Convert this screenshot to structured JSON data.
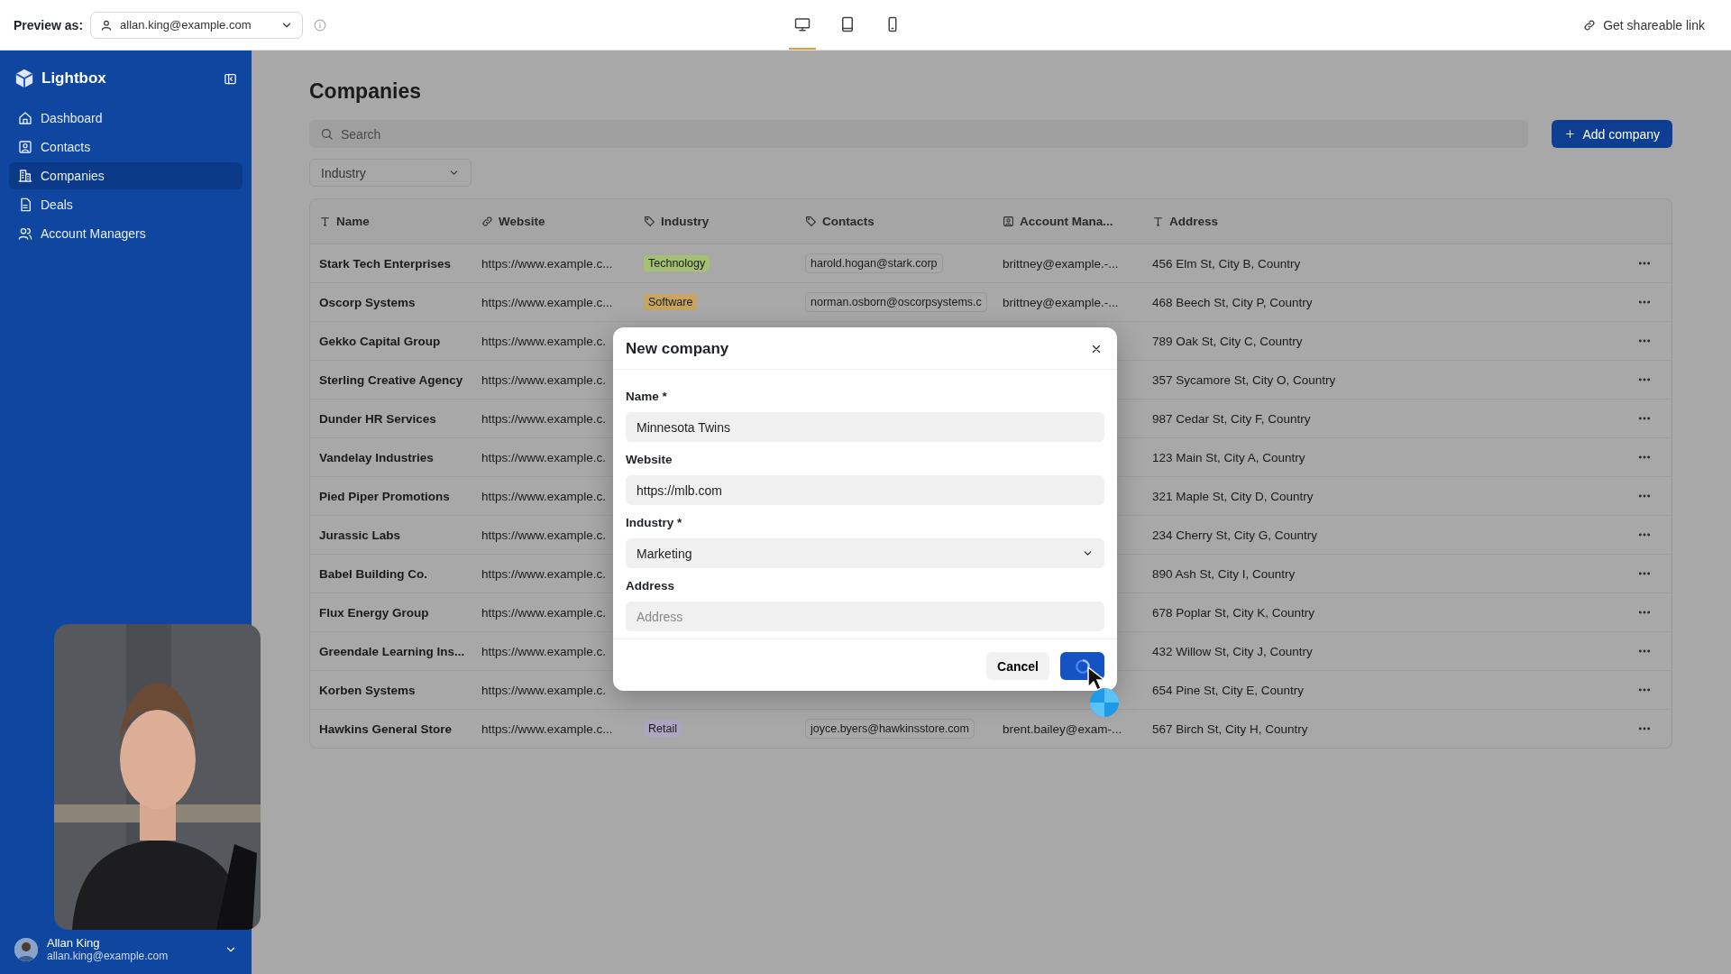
{
  "top_bar": {
    "preview_label": "Preview as:",
    "preview_user": "allan.king@example.com",
    "devices": [
      {
        "kind": "desktop",
        "selected": true
      },
      {
        "kind": "tablet",
        "selected": false
      },
      {
        "kind": "phone",
        "selected": false
      }
    ],
    "share_link": "Get shareable link"
  },
  "sidebar": {
    "brand": "Lightbox",
    "items": [
      {
        "kind": "home",
        "label": "Dashboard",
        "selected": false
      },
      {
        "kind": "contact",
        "label": "Contacts",
        "selected": false
      },
      {
        "kind": "building",
        "label": "Companies",
        "selected": true
      },
      {
        "kind": "file",
        "label": "Deals",
        "selected": false
      },
      {
        "kind": "users",
        "label": "Account Managers",
        "selected": false
      }
    ],
    "user": {
      "name": "Allan King",
      "email": "allan.king@example.com"
    }
  },
  "page": {
    "title": "Companies",
    "search": {
      "placeholder": "Search"
    },
    "add_button": "Add company",
    "filter": "Industry"
  },
  "table": {
    "columns": [
      {
        "kind": "text",
        "label": "Name"
      },
      {
        "kind": "link",
        "label": "Website"
      },
      {
        "kind": "tag",
        "label": "Industry"
      },
      {
        "kind": "tag",
        "label": "Contacts"
      },
      {
        "kind": "person",
        "label": "Account Mana..."
      },
      {
        "kind": "text",
        "label": "Address"
      }
    ],
    "rows": [
      {
        "name": "Stark Tech Enterprises",
        "website": "https://www.example.c...",
        "industry": {
          "label": "Technology",
          "color": "#a3c170"
        },
        "contact": "harold.hogan@stark.corp",
        "manager": "brittney@example.-...",
        "address": "456 Elm St, City B, Country"
      },
      {
        "name": "Oscorp Systems",
        "website": "https://www.example.c...",
        "industry": {
          "label": "Software",
          "color": "#c8a55e"
        },
        "contact": "norman.osborn@oscorpsystems.c",
        "manager": "brittney@example.-...",
        "address": "468 Beech St, City P, Country"
      },
      {
        "name": "Gekko Capital Group",
        "website": "https://www.example.c.",
        "address": "789 Oak St, City C, Country"
      },
      {
        "name": "Sterling Creative Agency",
        "website": "https://www.example.c.",
        "address": "357 Sycamore St, City O, Country"
      },
      {
        "name": "Dunder HR Services",
        "website": "https://www.example.c.",
        "address": "987 Cedar St, City F, Country"
      },
      {
        "name": "Vandelay Industries",
        "website": "https://www.example.c.",
        "address": "123 Main St, City A, Country"
      },
      {
        "name": "Pied Piper Promotions",
        "website": "https://www.example.c.",
        "address": "321 Maple St, City D, Country"
      },
      {
        "name": "Jurassic Labs",
        "website": "https://www.example.c.",
        "address": "234 Cherry St, City G, Country"
      },
      {
        "name": "Babel Building Co.",
        "website": "https://www.example.c.",
        "address": "890 Ash St, City I, Country"
      },
      {
        "name": "Flux Energy Group",
        "website": "https://www.example.c.",
        "address": "678 Poplar St, City K, Country"
      },
      {
        "name": "Greendale Learning Ins...",
        "website": "https://www.example.c.",
        "address": "432 Willow St, City J, Country"
      },
      {
        "name": "Korben Systems",
        "website": "https://www.example.c.",
        "address": "654 Pine St, City E, Country"
      },
      {
        "name": "Hawkins General Store",
        "website": "https://www.example.c...",
        "industry": {
          "label": "Retail",
          "color": "#aca6c4"
        },
        "contact": "joyce.byers@hawkinsstore.com",
        "manager": "brent.bailey@exam-...",
        "address": "567 Birch St, City H, Country"
      }
    ]
  },
  "dialog": {
    "title": "New company",
    "fields": [
      {
        "kind": "text",
        "label": "Name *",
        "value": "Minnesota Twins"
      },
      {
        "kind": "text",
        "label": "Website",
        "value": "https://mlb.com"
      },
      {
        "kind": "select",
        "label": "Industry *",
        "value": "Marketing"
      },
      {
        "kind": "text",
        "label": "Address",
        "placeholder": "Address"
      }
    ],
    "cancel": "Cancel",
    "saving": true
  }
}
